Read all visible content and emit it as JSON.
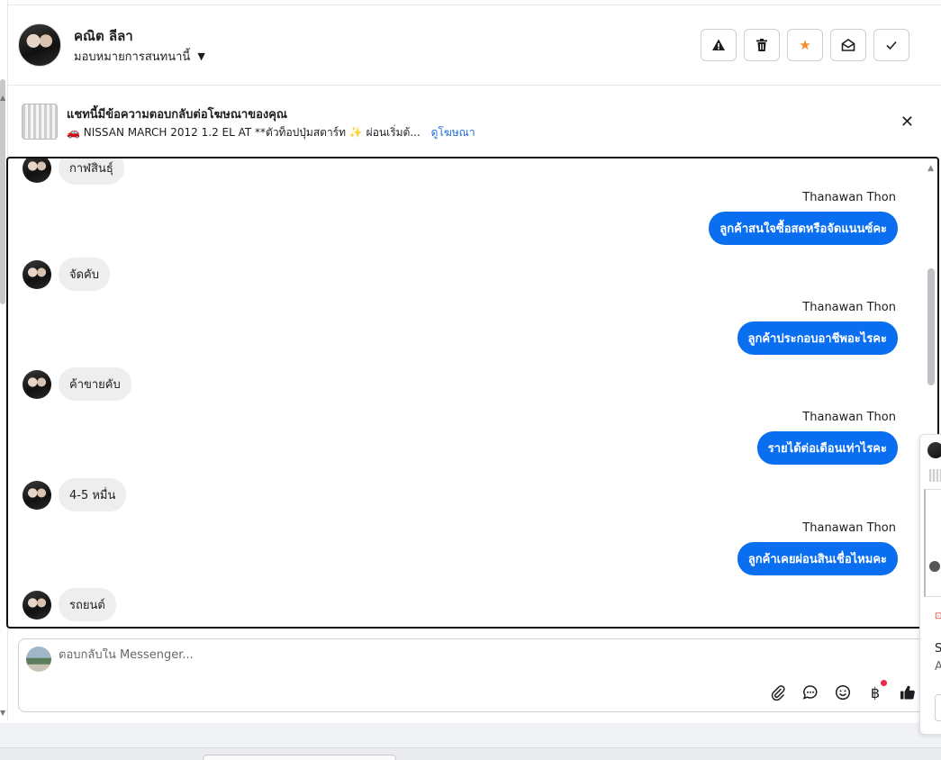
{
  "header": {
    "contact_name": "คณิต ลีลา",
    "assign_label": "มอบหมายการสนทนานี้",
    "actions": [
      {
        "name": "report-button",
        "icon": "warning-icon"
      },
      {
        "name": "delete-button",
        "icon": "trash-icon"
      },
      {
        "name": "star-button",
        "icon": "star-icon",
        "color": "#f28c28"
      },
      {
        "name": "mark-unread-button",
        "icon": "envelope-open-icon"
      },
      {
        "name": "mark-done-button",
        "icon": "check-icon"
      }
    ]
  },
  "ad": {
    "title": "แชทนี้มีข้อความตอบกลับต่อโฆษณาของคุณ",
    "subtitle": "NISSAN MARCH 2012 1.2 EL AT **ตัวท็อปปุ่มสตาร์ท",
    "subtitle_tail": "ผ่อนเริ่มต้...",
    "link": "ดูโฆษณา"
  },
  "messages": [
    {
      "dir": "in",
      "text": "กาฬสินธุ์"
    },
    {
      "dir": "out",
      "sender": "Thanawan Thon",
      "text": "ลูกค้าสนใจซื้อสดหรือจัดแนนซ์คะ"
    },
    {
      "dir": "in",
      "text": "จัดคับ"
    },
    {
      "dir": "out",
      "sender": "Thanawan Thon",
      "text": "ลูกค้าประกอบอาชีพอะไรคะ"
    },
    {
      "dir": "in",
      "text": "ค้าขายคับ"
    },
    {
      "dir": "out",
      "sender": "Thanawan Thon",
      "text": "รายได้ต่อเดือนเท่าไรคะ"
    },
    {
      "dir": "in",
      "text": "4-5 หมื่น"
    },
    {
      "dir": "out",
      "sender": "Thanawan Thon",
      "text": "ลูกค้าเคยผ่อนสินเชื่อไหมคะ"
    },
    {
      "dir": "in",
      "text": "รถยนต์"
    }
  ],
  "composer": {
    "placeholder": "ตอบกลับใน Messenger...",
    "tools": [
      "paperclip-icon",
      "chat-bubble-icon",
      "emoji-icon",
      "baht-icon",
      "thumbs-up-icon"
    ]
  },
  "side_panel": {
    "line1": "S",
    "line2": "A"
  },
  "colors": {
    "accent": "#0a6ef0",
    "link": "#216fdb",
    "star": "#f28c28",
    "notify_dot": "#f02849"
  }
}
